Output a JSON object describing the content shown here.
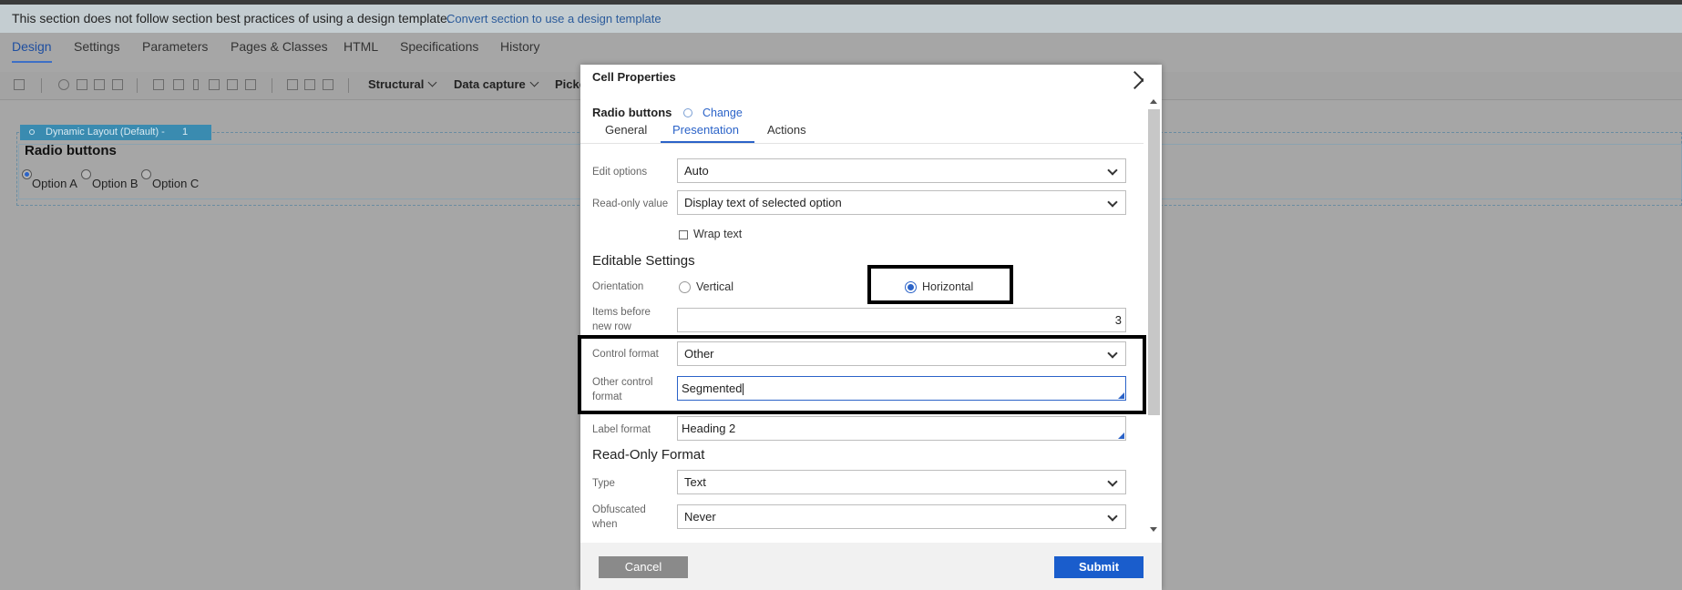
{
  "banner": {
    "message": "This section does not follow section best practices of using a design template.",
    "link": "Convert section to use a design template"
  },
  "tabs": [
    "Design",
    "Settings",
    "Parameters",
    "Pages & Classes",
    "HTML",
    "Specifications",
    "History"
  ],
  "toolbar": {
    "menus": [
      "Structural",
      "Data capture",
      "Picker"
    ]
  },
  "canvas": {
    "layout_header": "Dynamic Layout (Default) -",
    "layout_number": "1",
    "title": "Radio buttons",
    "options": [
      "Option A",
      "Option B",
      "Option C"
    ],
    "selected_option": "Option A"
  },
  "dialog": {
    "title": "Cell Properties",
    "control_name": "Radio buttons",
    "change_link": "Change",
    "tabs": [
      "General",
      "Presentation",
      "Actions"
    ],
    "active_tab": "Presentation",
    "fields": {
      "edit_options_label": "Edit options",
      "edit_options_value": "Auto",
      "readonly_value_label": "Read-only value",
      "readonly_value_value": "Display text of selected option",
      "wrap_text_label": "Wrap text",
      "editable_settings_header": "Editable Settings",
      "orientation_label": "Orientation",
      "orientation_vertical": "Vertical",
      "orientation_horizontal": "Horizontal",
      "orientation_selected": "Horizontal",
      "items_before_label_1": "Items before",
      "items_before_label_2": "new row",
      "items_before_value": "3",
      "control_format_label": "Control format",
      "control_format_value": "Other",
      "other_control_label_1": "Other control",
      "other_control_label_2": "format",
      "other_control_value": "Segmented",
      "label_format_label": "Label format",
      "label_format_value": "Heading 2",
      "readonly_format_header": "Read-Only Format",
      "type_label": "Type",
      "type_value": "Text",
      "obfuscated_label_1": "Obfuscated",
      "obfuscated_label_2": "when",
      "obfuscated_value": "Never"
    },
    "buttons": {
      "cancel": "Cancel",
      "submit": "Submit"
    }
  },
  "colors": {
    "accent": "#2b63c8",
    "submit": "#1a5dcc",
    "cancel": "#8a8a8a",
    "overlay": "#a6a6a6"
  }
}
